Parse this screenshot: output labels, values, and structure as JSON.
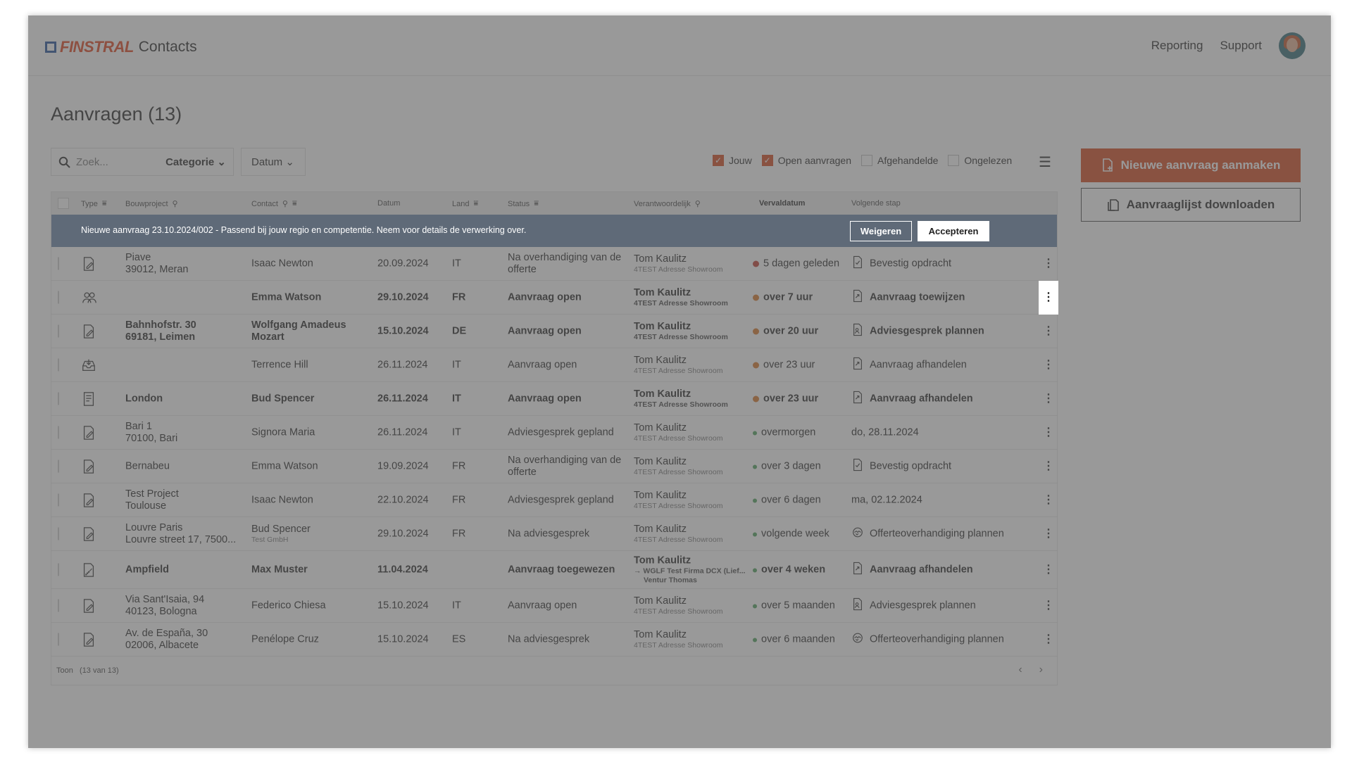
{
  "app": {
    "brand": "FINSTRAL",
    "name": "Contacts"
  },
  "nav": {
    "reporting": "Reporting",
    "support": "Support"
  },
  "page": {
    "title": "Aanvragen (13)"
  },
  "search": {
    "placeholder": "Zoek...",
    "category": "Categorie"
  },
  "datum_dropdown": "Datum",
  "filters": [
    {
      "label": "Jouw",
      "checked": true
    },
    {
      "label": "Open aanvragen",
      "checked": true
    },
    {
      "label": "Afgehandelde",
      "checked": false
    },
    {
      "label": "Ongelezen",
      "checked": false
    }
  ],
  "actions": {
    "new_request": "Nieuwe aanvraag aanmaken",
    "download_list": "Aanvraaglijst downloaden"
  },
  "columns": {
    "type": "Type",
    "bouwproject": "Bouwproject",
    "contact": "Contact",
    "datum": "Datum",
    "land": "Land",
    "status": "Status",
    "verantwoordelijk": "Verantwoordelijk",
    "vervaldatum": "Vervaldatum",
    "volgende_stap": "Volgende stap"
  },
  "notice": {
    "text": "Nieuwe aanvraag 23.10.2024/002 - Passend bij jouw regio en competentie. Neem voor details de verwerking over.",
    "reject": "Weigeren",
    "accept": "Accepteren"
  },
  "rows": [
    {
      "bold": false,
      "type_icon": "document-pen-icon",
      "proj1": "Piave",
      "proj2": "39012, Meran",
      "contact": "Isaac Newton",
      "contact_sub": "",
      "datum": "20.09.2024",
      "land": "IT",
      "status": "Na overhandiging van de offerte",
      "verant": "Tom Kaulitz",
      "verant_sub": "4TEST Adresse Showroom",
      "verant_sub2": "",
      "verv": "5 dagen geleden",
      "dot": "red",
      "next": "Bevestig opdracht",
      "next_icon": "doc-check-icon"
    },
    {
      "bold": true,
      "type_icon": "people-icon",
      "proj1": "",
      "proj2": "",
      "contact": "Emma Watson",
      "contact_sub": "",
      "datum": "29.10.2024",
      "land": "FR",
      "status": "Aanvraag open",
      "verant": "Tom Kaulitz",
      "verant_sub": "4TEST Adresse Showroom",
      "verant_sub2": "",
      "verv": "over 7 uur",
      "dot": "orange",
      "next": "Aanvraag toewijzen",
      "next_icon": "doc-arrow-icon"
    },
    {
      "bold": true,
      "type_icon": "document-pen-icon",
      "proj1": "Bahnhofstr. 30",
      "proj2": "69181, Leimen",
      "contact": "Wolfgang Amadeus Mozart",
      "contact_sub": "",
      "datum": "15.10.2024",
      "land": "DE",
      "status": "Aanvraag open",
      "verant": "Tom Kaulitz",
      "verant_sub": "4TEST Adresse Showroom",
      "verant_sub2": "",
      "verv": "over 20 uur",
      "dot": "orange",
      "next": "Adviesgesprek plannen",
      "next_icon": "doc-people-icon"
    },
    {
      "bold": false,
      "type_icon": "inbox-icon",
      "proj1": "",
      "proj2": "",
      "contact": "Terrence Hill",
      "contact_sub": "",
      "datum": "26.11.2024",
      "land": "IT",
      "status": "Aanvraag open",
      "verant": "Tom Kaulitz",
      "verant_sub": "4TEST Adresse Showroom",
      "verant_sub2": "",
      "verv": "over 23 uur",
      "dot": "orange",
      "next": "Aanvraag afhandelen",
      "next_icon": "doc-arrow-icon"
    },
    {
      "bold": true,
      "type_icon": "document-list-icon",
      "proj1": "London",
      "proj2": "",
      "contact": "Bud Spencer",
      "contact_sub": "",
      "datum": "26.11.2024",
      "land": "IT",
      "status": "Aanvraag open",
      "verant": "Tom Kaulitz",
      "verant_sub": "4TEST Adresse Showroom",
      "verant_sub2": "",
      "verv": "over 23 uur",
      "dot": "orange",
      "next": "Aanvraag afhandelen",
      "next_icon": "doc-arrow-icon"
    },
    {
      "bold": false,
      "type_icon": "document-pen-icon",
      "proj1": "Bari 1",
      "proj2": "70100, Bari",
      "contact": "Signora Maria",
      "contact_sub": "",
      "datum": "26.11.2024",
      "land": "IT",
      "status": "Adviesgesprek gepland",
      "verant": "Tom Kaulitz",
      "verant_sub": "4TEST Adresse Showroom",
      "verant_sub2": "",
      "verv": "overmorgen",
      "dot": "green",
      "next": "do, 28.11.2024",
      "next_icon": ""
    },
    {
      "bold": false,
      "type_icon": "document-pen-icon",
      "proj1": "Bernabeu",
      "proj2": "",
      "contact": "Emma Watson",
      "contact_sub": "",
      "datum": "19.09.2024",
      "land": "FR",
      "status": "Na overhandiging van de offerte",
      "verant": "Tom Kaulitz",
      "verant_sub": "4TEST Adresse Showroom",
      "verant_sub2": "",
      "verv": "over 3 dagen",
      "dot": "green",
      "next": "Bevestig opdracht",
      "next_icon": "doc-check-icon"
    },
    {
      "bold": false,
      "type_icon": "document-pen-icon",
      "proj1": "Test Project",
      "proj2": "Toulouse",
      "contact": "Isaac Newton",
      "contact_sub": "",
      "datum": "22.10.2024",
      "land": "FR",
      "status": "Adviesgesprek gepland",
      "verant": "Tom Kaulitz",
      "verant_sub": "4TEST Adresse Showroom",
      "verant_sub2": "",
      "verv": "over 6 dagen",
      "dot": "green",
      "next": "ma, 02.12.2024",
      "next_icon": ""
    },
    {
      "bold": false,
      "type_icon": "document-pen-icon",
      "proj1": "Louvre Paris",
      "proj2": "Louvre street 17, 7500...",
      "contact": "Bud Spencer",
      "contact_sub": "Test GmbH",
      "datum": "29.10.2024",
      "land": "FR",
      "status": "Na adviesgesprek",
      "verant": "Tom Kaulitz",
      "verant_sub": "4TEST Adresse Showroom",
      "verant_sub2": "",
      "verv": "volgende week",
      "dot": "green",
      "next": "Offerteoverhandiging plannen",
      "next_icon": "handshake-icon"
    },
    {
      "bold": true,
      "tall": true,
      "type_icon": "document-ruler-icon",
      "proj1": "Ampfield",
      "proj2": "",
      "contact": "Max Muster",
      "contact_sub": "",
      "datum": "11.04.2024",
      "land": "",
      "status": "Aanvraag toegewezen",
      "verant": "Tom Kaulitz",
      "verant_sub": "→ WGLF Test Firma DCX (Lief...",
      "verant_sub2": "Ventur Thomas",
      "verv": "over 4 weken",
      "dot": "green",
      "next": "Aanvraag afhandelen",
      "next_icon": "doc-arrow-icon"
    },
    {
      "bold": false,
      "type_icon": "document-pen-icon",
      "proj1": "Via Sant'Isaia, 94",
      "proj2": "40123, Bologna",
      "contact": "Federico Chiesa",
      "contact_sub": "",
      "datum": "15.10.2024",
      "land": "IT",
      "status": "Aanvraag open",
      "verant": "Tom Kaulitz",
      "verant_sub": "4TEST Adresse Showroom",
      "verant_sub2": "",
      "verv": "over 5 maanden",
      "dot": "green",
      "next": "Adviesgesprek plannen",
      "next_icon": "doc-people-icon"
    },
    {
      "bold": false,
      "type_icon": "document-pen-icon",
      "proj1": "Av. de España, 30",
      "proj2": "02006, Albacete",
      "contact": "Penélope Cruz",
      "contact_sub": "",
      "datum": "15.10.2024",
      "land": "ES",
      "status": "Na adviesgesprek",
      "verant": "Tom Kaulitz",
      "verant_sub": "4TEST Adresse Showroom",
      "verant_sub2": "",
      "verv": "over 6 maanden",
      "dot": "green",
      "next": "Offerteoverhandiging plannen",
      "next_icon": "handshake-icon"
    }
  ],
  "footer": {
    "label": "Toon",
    "count": "(13 van 13)"
  },
  "colors": {
    "accent": "#d4441a",
    "notice_bg": "#5f6a78",
    "overlay": "#5a5a5a"
  }
}
